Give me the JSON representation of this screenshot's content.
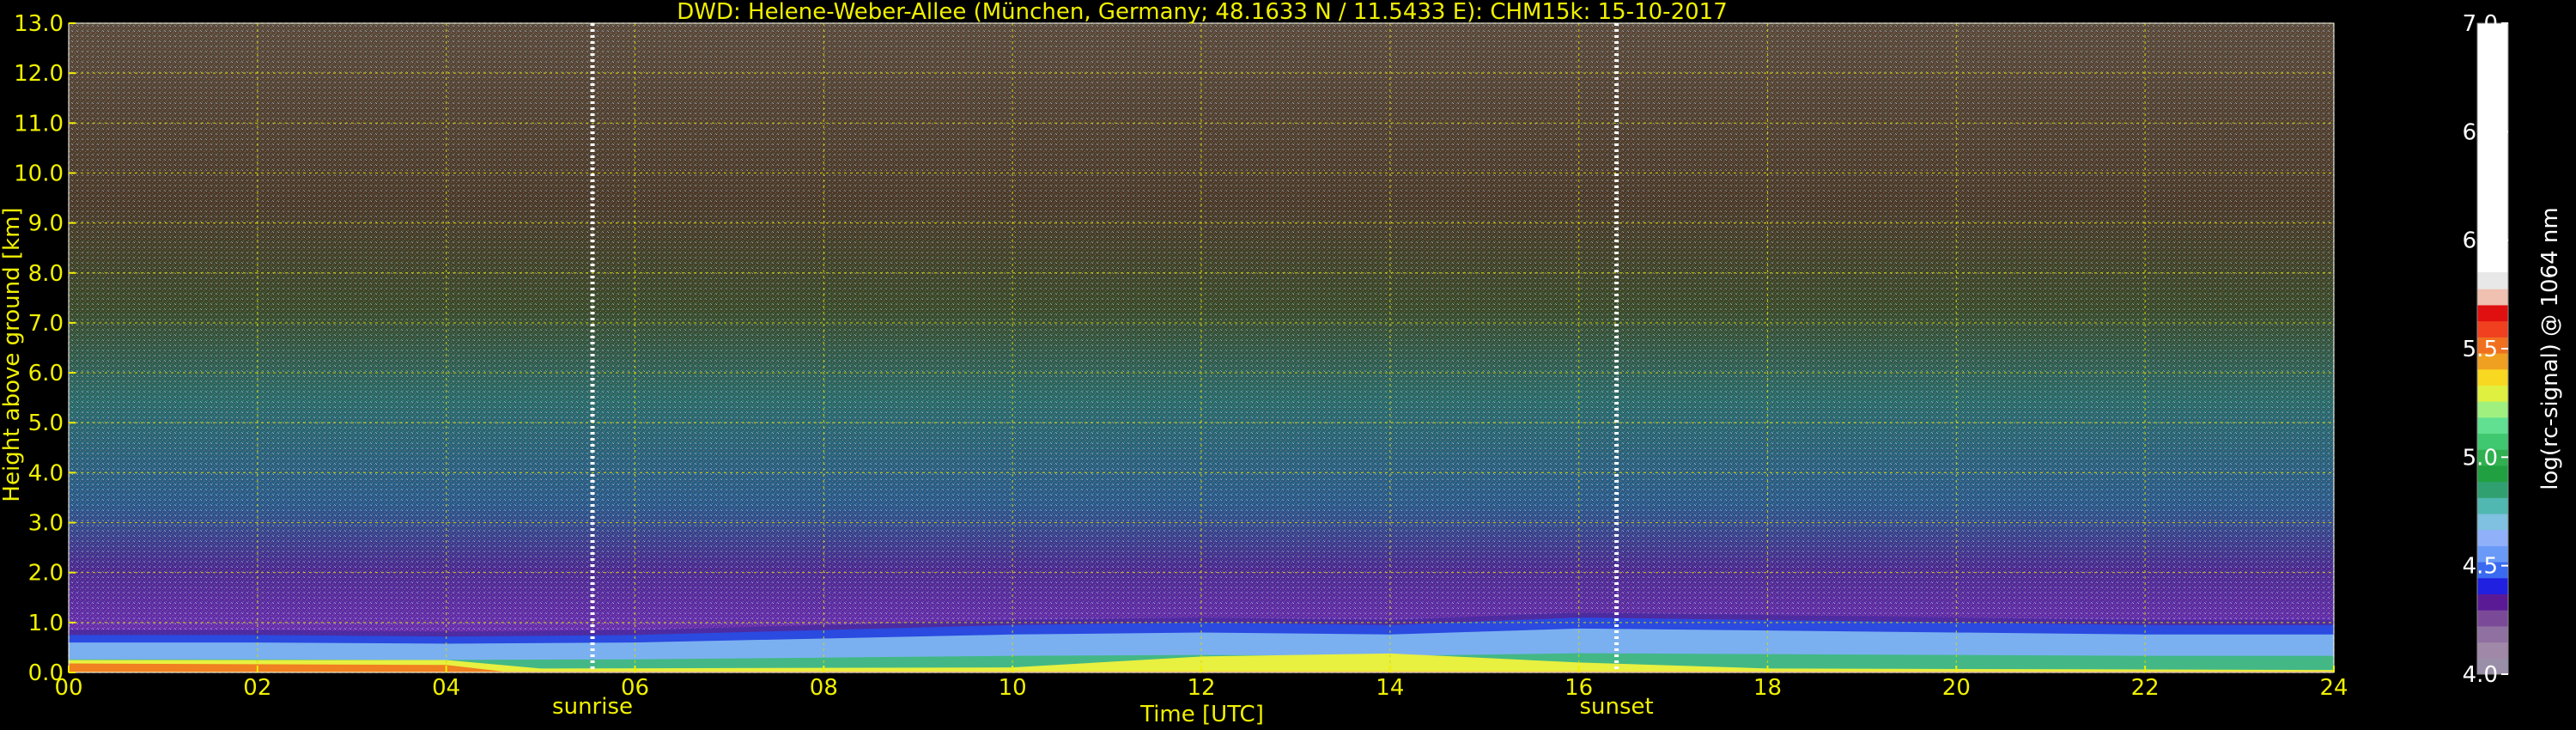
{
  "chart_data": {
    "type": "heatmap",
    "title": "DWD: Helene-Weber-Allee (München, Germany; 48.1633 N / 11.5433 E):    CHM15k: 15-10-2017",
    "xlabel": "Time [UTC]",
    "ylabel": "Height above ground [km]",
    "xlim": [
      0,
      24
    ],
    "ylim": [
      0,
      13
    ],
    "x_ticks": [
      0,
      2,
      4,
      6,
      8,
      10,
      12,
      14,
      16,
      18,
      20,
      22,
      24
    ],
    "x_tick_labels": [
      "00",
      "02",
      "04",
      "06",
      "08",
      "10",
      "12",
      "14",
      "16",
      "18",
      "20",
      "22",
      "24"
    ],
    "y_ticks": [
      0,
      1,
      2,
      3,
      4,
      5,
      6,
      7,
      8,
      9,
      10,
      11,
      12,
      13
    ],
    "y_tick_labels": [
      "0.0",
      "1.0",
      "2.0",
      "3.0",
      "4.0",
      "5.0",
      "6.0",
      "7.0",
      "8.0",
      "9.0",
      "10.0",
      "11.0",
      "12.0",
      "13.0"
    ],
    "grid": true,
    "colorbar": {
      "label": "log(rc-signal) @ 1064 nm",
      "range": [
        4.0,
        7.0
      ],
      "ticks": [
        4.0,
        4.5,
        5.0,
        5.5,
        6.0,
        6.5,
        7.0
      ],
      "tick_labels": [
        "4.0",
        "4.5",
        "5.0",
        "5.5",
        "6.0",
        "6.5",
        "7.0"
      ],
      "colors": [
        "#9a8fa8",
        "#a088a8",
        "#9070a0",
        "#7a4a98",
        "#5a1a96",
        "#2020e0",
        "#3a6af0",
        "#6a9af8",
        "#90b0fa",
        "#80c0e0",
        "#50b8b0",
        "#30a070",
        "#20a040",
        "#30b050",
        "#40c870",
        "#60e090",
        "#a0f080",
        "#e0f040",
        "#f8d820",
        "#f0a020",
        "#f07020",
        "#f04020",
        "#e01010",
        "#f0c0b0",
        "#e8e8e8",
        "#ffffff"
      ]
    },
    "annotations": [
      {
        "text": "sunrise",
        "x": 5.55
      },
      {
        "text": "sunset",
        "x": 16.4
      }
    ],
    "boundary_layer_height_km": [
      {
        "t": 0,
        "h": 0.75
      },
      {
        "t": 2,
        "h": 0.75
      },
      {
        "t": 4,
        "h": 0.72
      },
      {
        "t": 6,
        "h": 0.75
      },
      {
        "t": 8,
        "h": 0.85
      },
      {
        "t": 10,
        "h": 0.95
      },
      {
        "t": 12,
        "h": 1.0
      },
      {
        "t": 14,
        "h": 0.95
      },
      {
        "t": 16,
        "h": 1.1
      },
      {
        "t": 18,
        "h": 1.05
      },
      {
        "t": 20,
        "h": 1.0
      },
      {
        "t": 22,
        "h": 0.95
      },
      {
        "t": 24,
        "h": 0.95
      }
    ]
  }
}
